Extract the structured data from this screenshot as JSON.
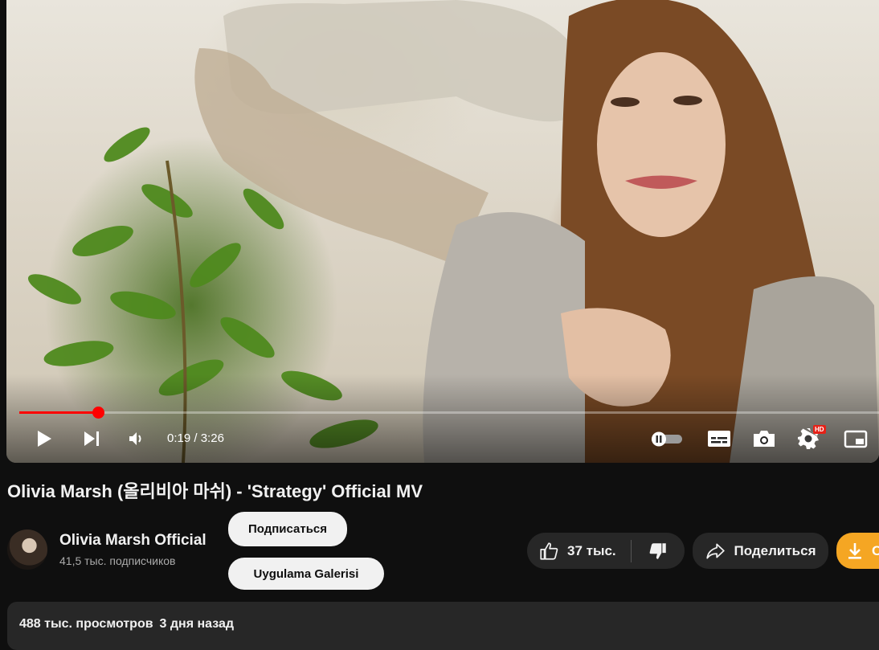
{
  "player": {
    "current_time": "0:19",
    "separator": "/",
    "duration": "3:26",
    "progress": 0.092,
    "hd_badge": "HD",
    "icons": [
      "play-icon",
      "next-icon",
      "volume-icon",
      "autoplay-toggle-icon",
      "subtitles-icon",
      "screenshot-icon",
      "settings-icon",
      "miniplayer-icon"
    ]
  },
  "video": {
    "title": "Olivia Marsh (올리비아 마쉬) - 'Strategy' Official MV"
  },
  "channel": {
    "name": "Olivia Marsh Official",
    "subscribers": "41,5 тыс. подписчиков",
    "subscribe_label": "Подписаться",
    "gallery_label": "Uygulama Galerisi"
  },
  "actions": {
    "likes": "37 тыс.",
    "share_label": "Поделиться",
    "download_label": "С"
  },
  "colors": {
    "accent": "#ff0000",
    "download_bg": "#f5a623",
    "pill_bg": "#272727"
  },
  "description": {
    "views": "488 тыс. просмотров",
    "date": "3 дня назад"
  }
}
